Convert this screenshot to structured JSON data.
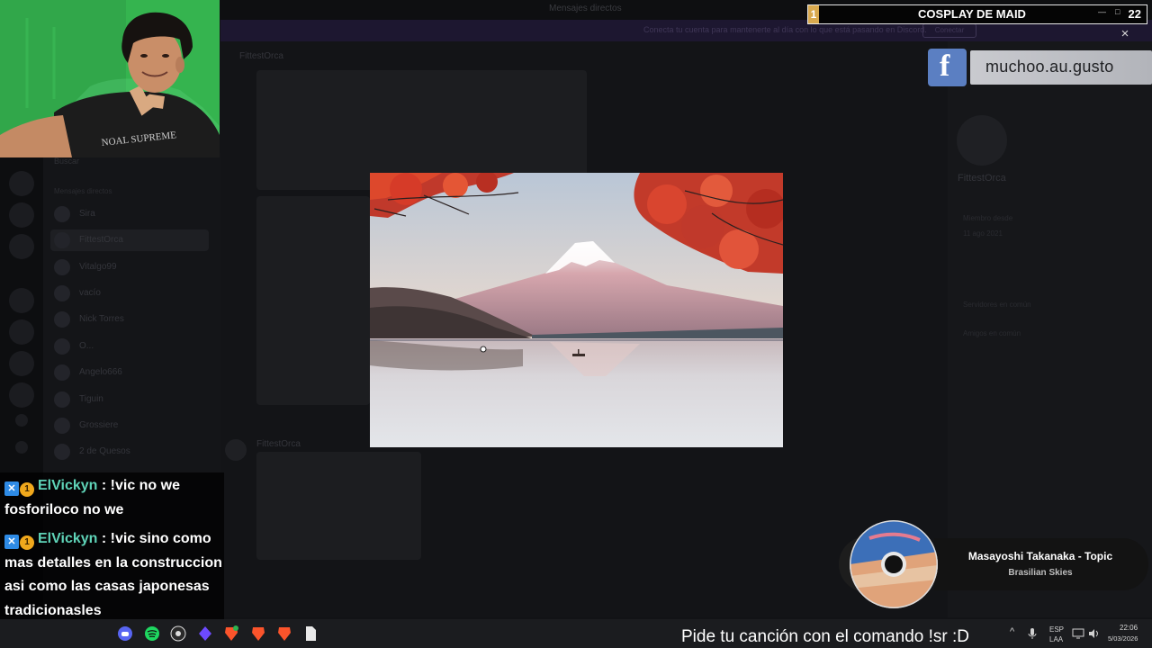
{
  "discord": {
    "top_title": "Mensajes directos",
    "banner_text": "Conecta tu cuenta para mantenerte al día con lo que está pasando en Discord.",
    "banner_button": "Conectar",
    "dm_header": "Buscar",
    "dm_section": "Mensajes directos",
    "dms": [
      "Sira",
      "FittestOrca",
      "Vitalgo99",
      "vacío",
      "Nick Torres",
      "O...",
      "Angelo666",
      "Tiguin",
      "Grossiere",
      "2 de Quesos"
    ],
    "chat_header": "FittestOrca",
    "chat_author": "FittestOrca",
    "profile_name": "FittestOrca",
    "profile_lines": [
      "Miembro desde",
      "11 ago 2021",
      "Servidores en común",
      "Amigos en común"
    ]
  },
  "overlay": {
    "goal": {
      "index": "1",
      "title": "COSPLAY DE MAID",
      "count": "22"
    },
    "close_label": "×",
    "facebook": {
      "icon": "facebook-icon",
      "handle": "muchoo.au.gusto"
    },
    "now_playing": {
      "title": "Masayoshi Takanaka - Topic",
      "artist": "Brasilian Skies"
    },
    "song_request": "Pide tu canción con el comando !sr :D"
  },
  "chat": {
    "messages": [
      {
        "user": "ElVickyn",
        "text": "!vic no we fosforiloco no we"
      },
      {
        "user": "ElVickyn",
        "text": "!vic sino como mas detalles en la construccion asi como las casas japonesas tradicionasles"
      }
    ],
    "badges": {
      "twitch": "twitch-badge-icon",
      "coin": "coin-badge-icon"
    }
  },
  "taskbar": {
    "icons": [
      "discord-icon",
      "spotify-icon",
      "obs-icon",
      "proton-icon",
      "brave-icon",
      "brave-icon",
      "brave-icon",
      "file-icon"
    ],
    "tray": {
      "lang_top": "ESP",
      "lang_bottom": "LAA",
      "time": "22:06",
      "date": "5/03/2026"
    }
  },
  "colors": {
    "chat_username": "#5fd4b8",
    "goal_accent": "#d8a94e",
    "facebook_blue": "#5b7fc2"
  }
}
